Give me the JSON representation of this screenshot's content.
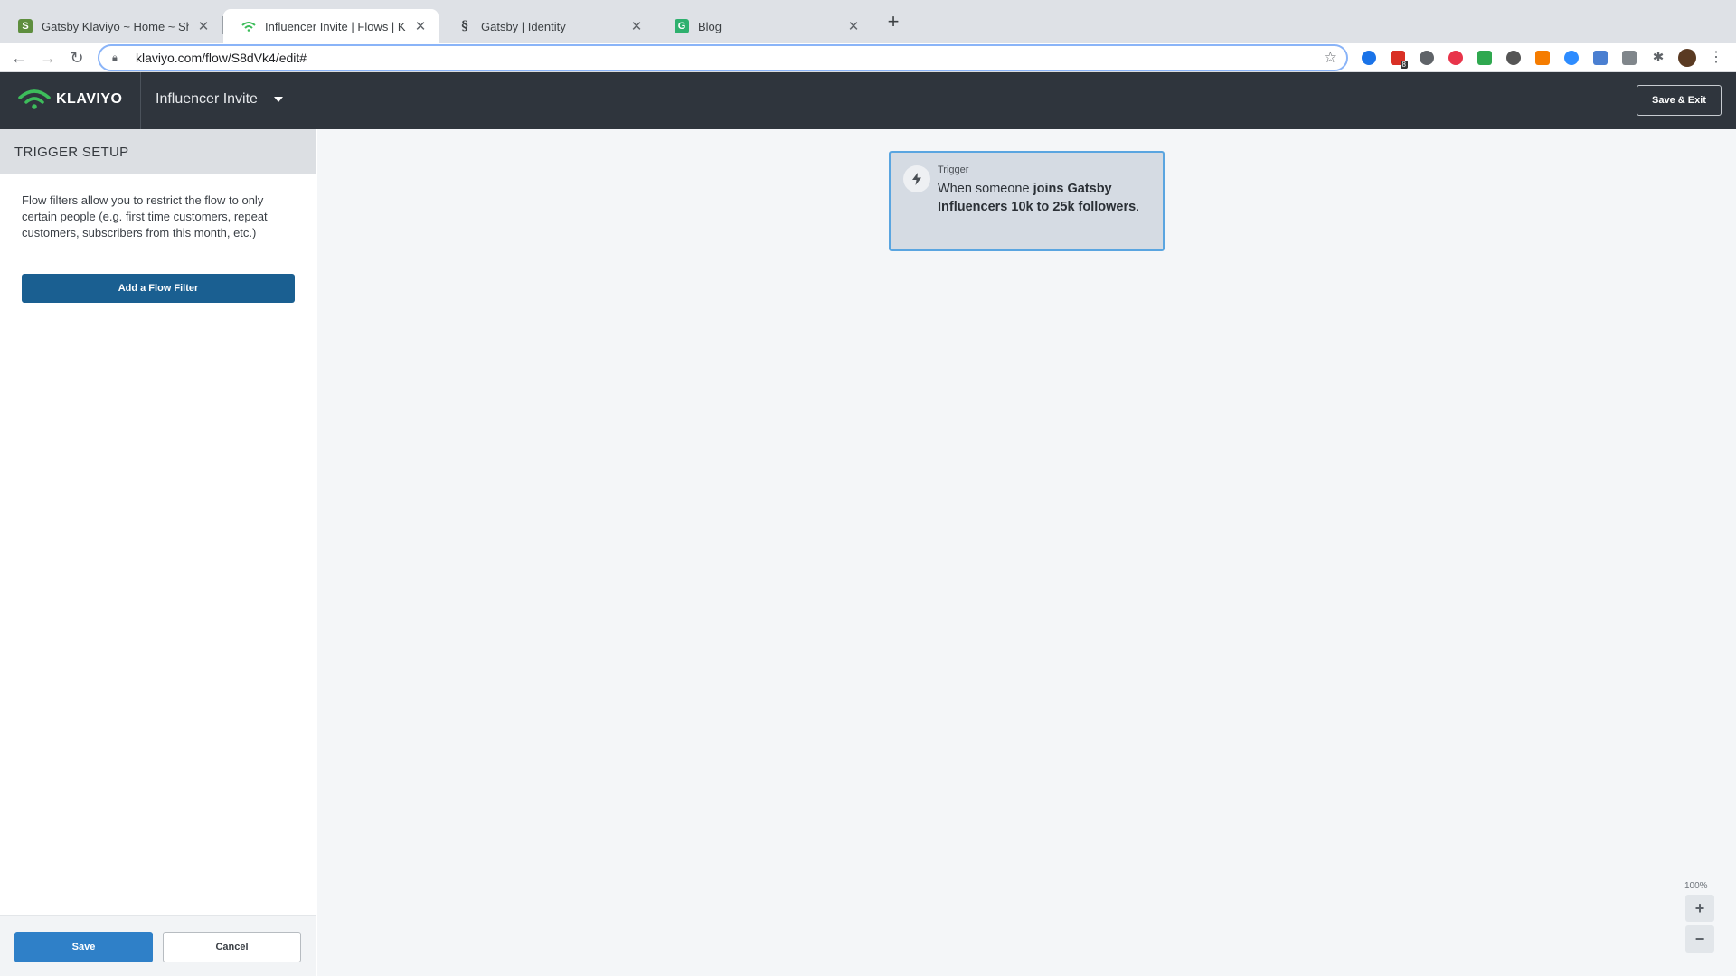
{
  "browser": {
    "tabs": [
      {
        "title": "Gatsby Klaviyo ~ Home ~ Shop",
        "favicon": "shopify-icon"
      },
      {
        "title": "Influencer Invite | Flows | Klavi",
        "favicon": "klaviyo-icon"
      },
      {
        "title": "Gatsby | Identity",
        "favicon": "gatsby-icon"
      },
      {
        "title": "Blog",
        "favicon": "g-icon"
      }
    ],
    "url": "klaviyo.com/flow/S8dVk4/edit#",
    "extension_badge": "8"
  },
  "header": {
    "logo_text": "KLAVIYO",
    "flow_name": "Influencer Invite",
    "save_exit_label": "Save & Exit"
  },
  "sidebar": {
    "title": "TRIGGER SETUP",
    "description": "Flow filters allow you to restrict the flow to only certain people (e.g. first time customers, repeat customers, subscribers from this month, etc.)",
    "add_filter_label": "Add a Flow Filter",
    "save_label": "Save",
    "cancel_label": "Cancel"
  },
  "canvas": {
    "trigger": {
      "label": "Trigger",
      "text_prefix": "When someone ",
      "text_bold": "joins Gatsby Influencers 10k to 25k followers",
      "text_suffix": "."
    },
    "zoom_level": "100%",
    "zoom_in": "+",
    "zoom_out": "−"
  },
  "colors": {
    "header_bg": "#2f353d",
    "primary_button": "#1a5f91",
    "save_button": "#2f80c8",
    "trigger_border": "#5aa5e0",
    "logo_green": "#3dbd5b"
  }
}
